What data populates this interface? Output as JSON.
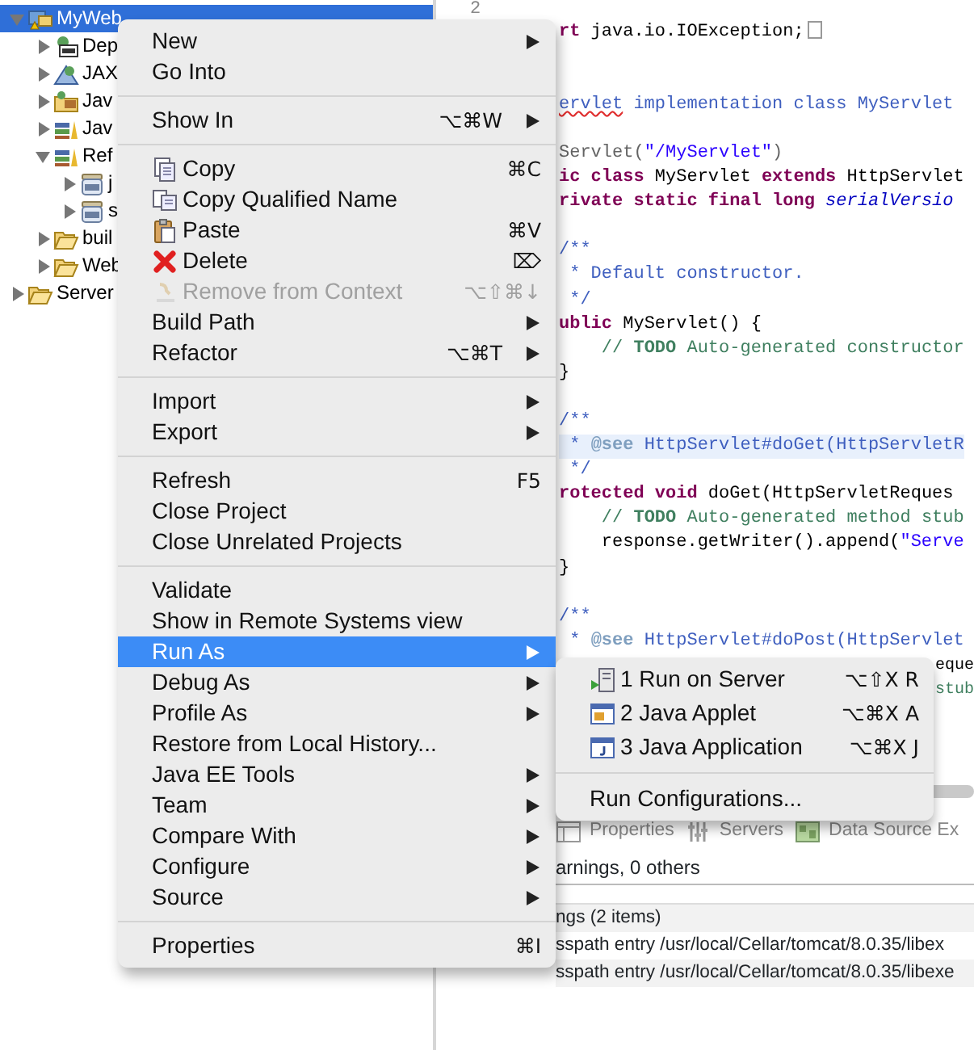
{
  "tree": [
    {
      "label": "MyWeb",
      "kind": "project",
      "expanded": true,
      "selected": true,
      "children": [
        {
          "label": "Dep",
          "kind": "descriptor",
          "expanded": false,
          "selected": false
        },
        {
          "label": "JAX",
          "kind": "webservice",
          "expanded": false,
          "selected": false
        },
        {
          "label": "Jav",
          "kind": "resources",
          "expanded": false,
          "selected": false
        },
        {
          "label": "Jav",
          "kind": "library",
          "expanded": false,
          "selected": false
        },
        {
          "label": "Ref",
          "kind": "library",
          "expanded": true,
          "selected": false,
          "children": [
            {
              "label": "j",
              "kind": "jar",
              "expanded": false,
              "selected": false
            },
            {
              "label": "s",
              "kind": "jar",
              "expanded": false,
              "selected": false
            }
          ]
        },
        {
          "label": "buil",
          "kind": "folder",
          "expanded": false,
          "selected": false
        },
        {
          "label": "Web",
          "kind": "folder",
          "expanded": false,
          "selected": false
        }
      ]
    },
    {
      "label": "Server",
      "kind": "folder",
      "expanded": false,
      "selected": false
    }
  ],
  "editor": {
    "line_number": "2",
    "lines": [
      {
        "kind": "code",
        "fold_marker": true,
        "segments": [
          {
            "kind": "keyword",
            "text": "rt"
          },
          {
            "kind": "plain",
            "text": " java.io.IOException;"
          }
        ]
      },
      {
        "kind": "blank"
      },
      {
        "kind": "blank"
      },
      {
        "kind": "code",
        "segments": [
          {
            "kind": "doc-typo",
            "text": "ervlet"
          },
          {
            "kind": "doc",
            "text": " implementation class MyServlet"
          }
        ]
      },
      {
        "kind": "blank"
      },
      {
        "kind": "code",
        "segments": [
          {
            "kind": "annotation",
            "text": "Servlet("
          },
          {
            "kind": "string",
            "text": "\"/MyServlet\""
          },
          {
            "kind": "annotation",
            "text": ")"
          }
        ]
      },
      {
        "kind": "code",
        "segments": [
          {
            "kind": "keyword",
            "text": "ic class"
          },
          {
            "kind": "plain",
            "text": " MyServlet "
          },
          {
            "kind": "keyword",
            "text": "extends"
          },
          {
            "kind": "plain",
            "text": " HttpServlet"
          }
        ]
      },
      {
        "kind": "code",
        "segments": [
          {
            "kind": "keyword",
            "text": "rivate static final long"
          },
          {
            "kind": "field",
            "text": " serialVersio"
          }
        ]
      },
      {
        "kind": "blank"
      },
      {
        "kind": "code",
        "segments": [
          {
            "kind": "doc",
            "text": "/**"
          }
        ]
      },
      {
        "kind": "code",
        "segments": [
          {
            "kind": "doc",
            "text": " * Default constructor."
          }
        ]
      },
      {
        "kind": "code",
        "segments": [
          {
            "kind": "doc",
            "text": " */"
          }
        ]
      },
      {
        "kind": "code",
        "segments": [
          {
            "kind": "keyword",
            "text": "ublic"
          },
          {
            "kind": "plain",
            "text": " MyServlet() {"
          }
        ]
      },
      {
        "kind": "code",
        "segments": [
          {
            "kind": "comment",
            "text": "    // "
          },
          {
            "kind": "task",
            "text": "TODO"
          },
          {
            "kind": "comment",
            "text": " Auto-generated constructor"
          }
        ]
      },
      {
        "kind": "code",
        "segments": [
          {
            "kind": "plain",
            "text": "}"
          }
        ]
      },
      {
        "kind": "blank"
      },
      {
        "kind": "code",
        "segments": [
          {
            "kind": "doc",
            "text": "/**"
          }
        ]
      },
      {
        "kind": "code",
        "highlighted": true,
        "segments": [
          {
            "kind": "doc",
            "text": " * "
          },
          {
            "kind": "doc-tag",
            "text": "@see"
          },
          {
            "kind": "doc",
            "text": " HttpServlet#doGet(HttpServletR"
          }
        ]
      },
      {
        "kind": "code",
        "segments": [
          {
            "kind": "doc",
            "text": " */"
          }
        ]
      },
      {
        "kind": "code",
        "segments": [
          {
            "kind": "keyword",
            "text": "rotected void"
          },
          {
            "kind": "plain",
            "text": " doGet(HttpServletReques"
          }
        ]
      },
      {
        "kind": "code",
        "segments": [
          {
            "kind": "comment",
            "text": "    // "
          },
          {
            "kind": "task",
            "text": "TODO"
          },
          {
            "kind": "comment",
            "text": " Auto-generated method stub"
          }
        ]
      },
      {
        "kind": "code",
        "segments": [
          {
            "kind": "plain",
            "text": "    response.getWriter().append("
          },
          {
            "kind": "string",
            "text": "\"Serve"
          }
        ]
      },
      {
        "kind": "code",
        "segments": [
          {
            "kind": "plain",
            "text": "}"
          }
        ]
      },
      {
        "kind": "blank"
      },
      {
        "kind": "code",
        "segments": [
          {
            "kind": "doc",
            "text": "/**"
          }
        ]
      },
      {
        "kind": "code",
        "segments": [
          {
            "kind": "doc",
            "text": " * "
          },
          {
            "kind": "doc-tag",
            "text": "@see"
          },
          {
            "kind": "doc",
            "text": " HttpServlet#doPost(HttpServlet"
          }
        ]
      },
      {
        "kind": "tail",
        "segments": [
          {
            "kind": "plain",
            "text": "eque"
          }
        ]
      },
      {
        "kind": "tail",
        "segments": [
          {
            "kind": "comment",
            "text": "stub"
          }
        ]
      }
    ]
  },
  "bottom_panel": {
    "tabs": [
      {
        "label": "Properties",
        "kind": "properties"
      },
      {
        "label": "Servers",
        "kind": "servers"
      },
      {
        "label": "Data Source Ex",
        "kind": "datasource"
      }
    ],
    "summary": "arnings, 0 others",
    "rows": [
      "ngs (2 items)",
      "sspath entry /usr/local/Cellar/tomcat/8.0.35/libex",
      "sspath entry /usr/local/Cellar/tomcat/8.0.35/libexe"
    ]
  },
  "context_menu": {
    "groups": [
      [
        {
          "label": "New",
          "submenu": true,
          "disabled": false,
          "selected": false
        },
        {
          "label": "Go Into",
          "submenu": false,
          "disabled": false,
          "selected": false
        }
      ],
      [
        {
          "label": "Show In",
          "shortcut": "⌥⌘W",
          "submenu": true,
          "disabled": false,
          "selected": false
        }
      ],
      [
        {
          "label": "Copy",
          "kind": "copy",
          "shortcut": "⌘C",
          "submenu": false,
          "disabled": false,
          "selected": false
        },
        {
          "label": "Copy Qualified Name",
          "kind": "copy-qualified",
          "submenu": false,
          "disabled": false,
          "selected": false
        },
        {
          "label": "Paste",
          "kind": "paste",
          "shortcut": "⌘V",
          "submenu": false,
          "disabled": false,
          "selected": false
        },
        {
          "label": "Delete",
          "kind": "delete",
          "shortcut": "⌦",
          "submenu": false,
          "disabled": false,
          "selected": false
        },
        {
          "label": "Remove from Context",
          "kind": "remove",
          "shortcut": "⌥⇧⌘↓",
          "submenu": false,
          "disabled": true,
          "selected": false
        },
        {
          "label": "Build Path",
          "submenu": true,
          "disabled": false,
          "selected": false
        },
        {
          "label": "Refactor",
          "shortcut": "⌥⌘T",
          "submenu": true,
          "disabled": false,
          "selected": false
        }
      ],
      [
        {
          "label": "Import",
          "submenu": true,
          "disabled": false,
          "selected": false
        },
        {
          "label": "Export",
          "submenu": true,
          "disabled": false,
          "selected": false
        }
      ],
      [
        {
          "label": "Refresh",
          "shortcut": "F5",
          "submenu": false,
          "disabled": false,
          "selected": false
        },
        {
          "label": "Close Project",
          "submenu": false,
          "disabled": false,
          "selected": false
        },
        {
          "label": "Close Unrelated Projects",
          "submenu": false,
          "disabled": false,
          "selected": false
        }
      ],
      [
        {
          "label": "Validate",
          "submenu": false,
          "disabled": false,
          "selected": false
        },
        {
          "label": "Show in Remote Systems view",
          "submenu": false,
          "disabled": false,
          "selected": false
        },
        {
          "label": "Run As",
          "submenu": true,
          "disabled": false,
          "selected": true
        },
        {
          "label": "Debug As",
          "submenu": true,
          "disabled": false,
          "selected": false
        },
        {
          "label": "Profile As",
          "submenu": true,
          "disabled": false,
          "selected": false
        },
        {
          "label": "Restore from Local History...",
          "submenu": false,
          "disabled": false,
          "selected": false
        },
        {
          "label": "Java EE Tools",
          "submenu": true,
          "disabled": false,
          "selected": false
        },
        {
          "label": "Team",
          "submenu": true,
          "disabled": false,
          "selected": false
        },
        {
          "label": "Compare With",
          "submenu": true,
          "disabled": false,
          "selected": false
        },
        {
          "label": "Configure",
          "submenu": true,
          "disabled": false,
          "selected": false
        },
        {
          "label": "Source",
          "submenu": true,
          "disabled": false,
          "selected": false
        }
      ],
      [
        {
          "label": "Properties",
          "shortcut": "⌘I",
          "submenu": false,
          "disabled": false,
          "selected": false
        }
      ]
    ]
  },
  "run_as_submenu": {
    "groups": [
      [
        {
          "label": "1 Run on Server",
          "kind": "run-server",
          "shortcut": "⌥⇧X R"
        },
        {
          "label": "2 Java Applet",
          "kind": "applet",
          "shortcut": "⌥⌘X A"
        },
        {
          "label": "3 Java Application",
          "kind": "java-app",
          "shortcut": "⌥⌘X J"
        }
      ],
      [
        {
          "label": "Run Configurations..."
        }
      ]
    ]
  }
}
